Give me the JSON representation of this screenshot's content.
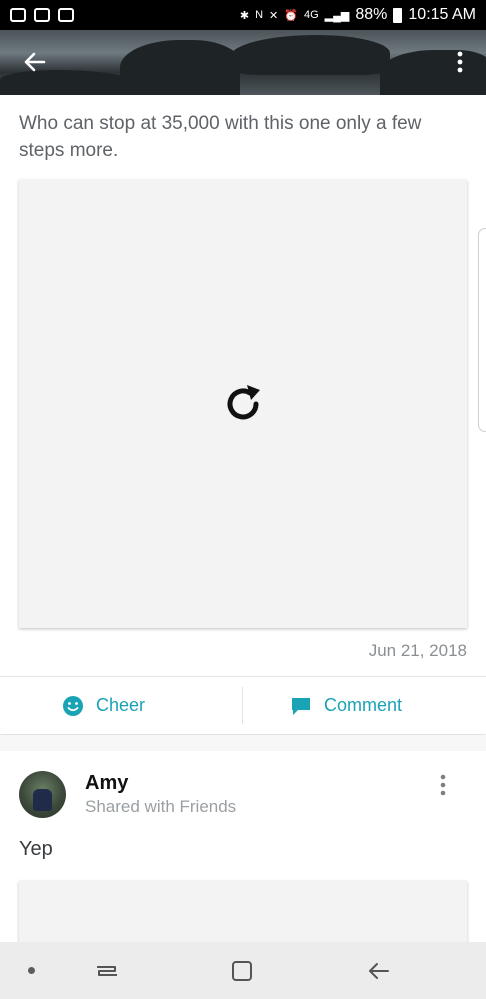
{
  "status_bar": {
    "battery": "88%",
    "time": "10:15 AM",
    "network": "4G"
  },
  "post": {
    "caption": "Who can stop at 35,000 with this one only a few steps more.",
    "date": "Jun 21, 2018"
  },
  "actions": {
    "cheer_label": "Cheer",
    "comment_label": "Comment"
  },
  "comment": {
    "name": "Amy",
    "visibility": "Shared with Friends",
    "text": "Yep"
  },
  "colors": {
    "accent": "#1aa3b4",
    "text": "#5f6368",
    "card": "#f3f3f3"
  },
  "icons": [
    "back-arrow-icon",
    "more-vert-icon",
    "reload-icon",
    "smiley-icon",
    "comment-bubble-icon",
    "nav-recent-icon",
    "nav-home-icon",
    "nav-back-icon"
  ]
}
